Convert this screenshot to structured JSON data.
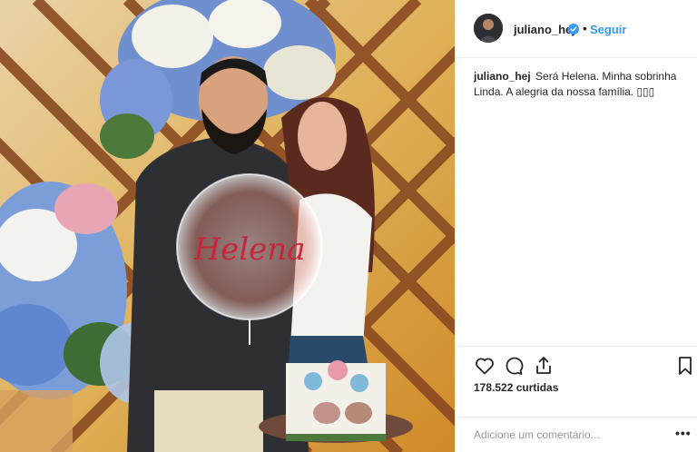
{
  "post": {
    "username": "juliano_hej",
    "follow_label": "Seguir",
    "dot": "•",
    "caption_user": "juliano_hej",
    "caption_text": "Será Helena. Minha sobrinha Linda. A alegria da nossa família. ▯▯▯",
    "photo_balloon_text": "Helena",
    "likes": "178.522 curtidas",
    "comment_placeholder": "Adicione um comentário...",
    "more_label": "•••"
  },
  "icons": {
    "avatar": "avatar",
    "verified": "verified-badge-icon",
    "like": "heart-icon",
    "comment": "comment-bubble-icon",
    "share": "share-icon",
    "save": "bookmark-icon",
    "more": "more-dots-icon"
  },
  "colors": {
    "link": "#3897f0",
    "text": "#262626",
    "muted": "#999999",
    "border": "#efefef"
  }
}
